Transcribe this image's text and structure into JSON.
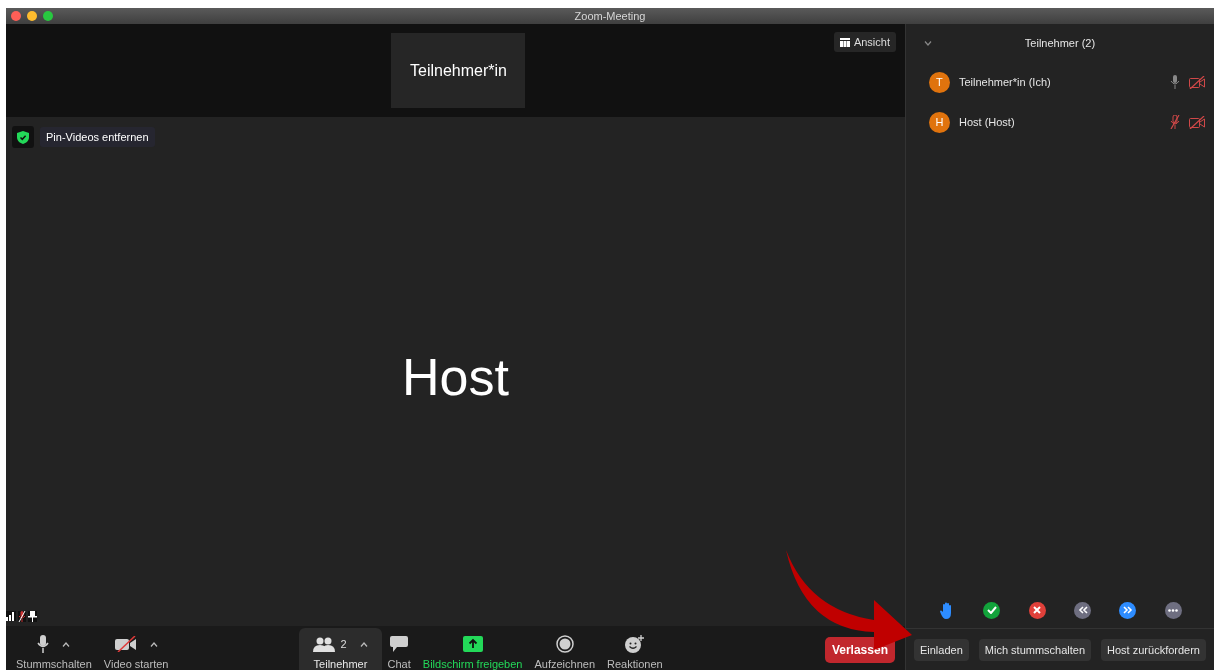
{
  "window": {
    "title": "Zoom-Meeting"
  },
  "thumbnail": {
    "name": "Teilnehmer*in"
  },
  "view_button": {
    "label": "Ansicht"
  },
  "pin_notice": {
    "label": "Pin-Videos entfernen"
  },
  "main_video": {
    "name": "Host"
  },
  "toolbar": [
    {
      "kind": "mic",
      "label": "Stummschalten",
      "caret": true,
      "selected": false
    },
    {
      "kind": "video",
      "label": "Video starten",
      "caret": true,
      "selected": false
    },
    {
      "kind": "participants",
      "label": "Teilnehmer",
      "count": "2",
      "caret": true,
      "selected": true
    },
    {
      "kind": "chat",
      "label": "Chat",
      "caret": false,
      "selected": false
    },
    {
      "kind": "share",
      "label": "Bildschirm freigeben",
      "caret": false,
      "selected": false
    },
    {
      "kind": "record",
      "label": "Aufzeichnen",
      "caret": false,
      "selected": false
    },
    {
      "kind": "reactions",
      "label": "Reaktionen",
      "caret": false,
      "selected": false
    }
  ],
  "leave_button": {
    "label": "Verlassen"
  },
  "panel": {
    "title": "Teilnehmer (2)",
    "participants": [
      {
        "initial": "T",
        "name": "Teilnehmer*in (Ich)",
        "muted": false,
        "video_off": true
      },
      {
        "initial": "H",
        "name": "Host (Host)",
        "muted": true,
        "video_off": true
      }
    ],
    "reactions": [
      {
        "kind": "hand"
      },
      {
        "kind": "yes"
      },
      {
        "kind": "no"
      },
      {
        "kind": "slower"
      },
      {
        "kind": "faster"
      },
      {
        "kind": "more"
      }
    ],
    "buttons": [
      "Einladen",
      "Mich stummschalten",
      "Host zurückfordern"
    ]
  }
}
